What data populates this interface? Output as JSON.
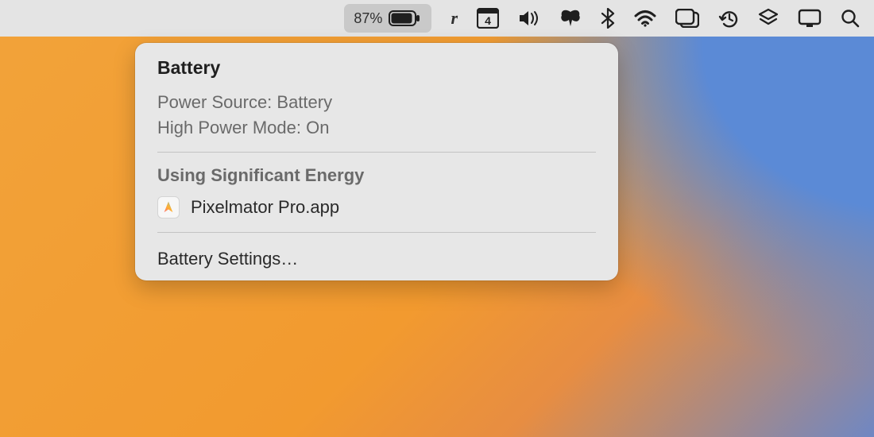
{
  "menubar": {
    "battery_percent": "87%",
    "calendar_day": "4"
  },
  "popover": {
    "title": "Battery",
    "power_source_line": "Power Source: Battery",
    "power_mode_line": "High Power Mode: On",
    "energy_section_title": "Using Significant Energy",
    "apps": [
      {
        "name": "Pixelmator Pro.app"
      }
    ],
    "settings_label": "Battery Settings…"
  }
}
